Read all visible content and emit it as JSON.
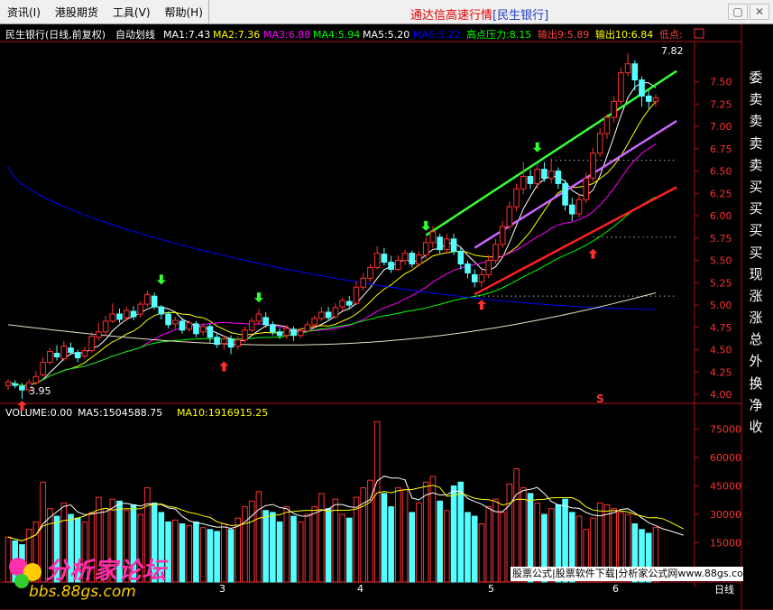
{
  "menu": {
    "items": [
      "资讯(I)",
      "港股期货",
      "工具(V)",
      "帮助(H)"
    ],
    "title_prefix": "通达信高速行情",
    "title_stock": "[民生银行]"
  },
  "window": {
    "restore_glyph": "▢",
    "close_glyph": "✕"
  },
  "header": {
    "name": "民生银行(日线,前复权)",
    "autodraw": "自动划线",
    "ma": [
      {
        "label": "MA1:7.43",
        "color": "#ffffff"
      },
      {
        "label": "MA2:7.36",
        "color": "#ffff00"
      },
      {
        "label": "MA3:6.88",
        "color": "#ff00ff"
      },
      {
        "label": "MA4:5.94",
        "color": "#00ff00"
      },
      {
        "label": "MA5:5.20",
        "color": "#ffffff"
      },
      {
        "label": "MA6:5.22",
        "color": "#0000ff"
      }
    ],
    "indicators": [
      {
        "label": "高点压力:8.15",
        "color": "#00ff00"
      },
      {
        "label": "输出9:5.89",
        "color": "#ff4040"
      },
      {
        "label": "输出10:6.84",
        "color": "#ffff00"
      },
      {
        "label": "低点:",
        "color": "#ff4040"
      }
    ]
  },
  "price_axis": [
    "7.50",
    "7.25",
    "7.00",
    "6.75",
    "6.50",
    "6.25",
    "6.00",
    "5.75",
    "5.50",
    "5.25",
    "5.00",
    "4.75",
    "4.50",
    "4.25",
    "4.00"
  ],
  "price_labels": {
    "high": "7.82",
    "low": "3.95",
    "marker": "S"
  },
  "right_panel": {
    "items": [
      "委",
      "卖",
      "卖",
      "卖",
      "卖",
      "买",
      "买",
      "买",
      "买",
      "现",
      "涨",
      "涨",
      "总",
      "外",
      "换",
      "净",
      "收"
    ],
    "colors": [
      "#ffffff",
      "#ffffff",
      "#ffffff",
      "#ffffff",
      "#ffffff",
      "#ffffff",
      "#ffffff",
      "#ffffff",
      "#ffffff",
      "#ffffff",
      "#ffffff",
      "#ffffff",
      "#ffffff",
      "#ffffff",
      "#ffffff",
      "#ffffff",
      "#ffffff"
    ]
  },
  "volume": {
    "header": "VOLUME:0.00",
    "ma5": "MA5:1504588.75",
    "ma10": "MA10:1916915.25",
    "axis": [
      "75000",
      "60000",
      "45000",
      "30000",
      "15000"
    ]
  },
  "time_axis": [
    "3",
    "4",
    "5",
    "6"
  ],
  "bottom": {
    "period": "日线"
  },
  "watermark": "股票公式|股票软件下载|分析家公式网www.88gs.com",
  "logo": {
    "brand": "分析家论坛",
    "url": "bbs.88gs.com"
  },
  "chart_data": {
    "type": "candlestick",
    "ylim": [
      3.9,
      7.95
    ],
    "candles": [
      {
        "o": 4.1,
        "c": 4.14,
        "h": 4.17,
        "l": 4.05
      },
      {
        "o": 4.12,
        "c": 4.1,
        "h": 4.16,
        "l": 4.07
      },
      {
        "o": 4.09,
        "c": 4.05,
        "h": 4.13,
        "l": 3.95
      },
      {
        "o": 4.05,
        "c": 4.13,
        "h": 4.17,
        "l": 4.02
      },
      {
        "o": 4.13,
        "c": 4.2,
        "h": 4.26,
        "l": 4.11
      },
      {
        "o": 4.22,
        "c": 4.36,
        "h": 4.42,
        "l": 4.2
      },
      {
        "o": 4.36,
        "c": 4.48,
        "h": 4.52,
        "l": 4.33
      },
      {
        "o": 4.46,
        "c": 4.42,
        "h": 4.55,
        "l": 4.38
      },
      {
        "o": 4.4,
        "c": 4.54,
        "h": 4.6,
        "l": 4.37
      },
      {
        "o": 4.52,
        "c": 4.47,
        "h": 4.58,
        "l": 4.44
      },
      {
        "o": 4.47,
        "c": 4.41,
        "h": 4.5,
        "l": 4.36
      },
      {
        "o": 4.43,
        "c": 4.49,
        "h": 4.53,
        "l": 4.4
      },
      {
        "o": 4.49,
        "c": 4.65,
        "h": 4.7,
        "l": 4.47
      },
      {
        "o": 4.64,
        "c": 4.7,
        "h": 4.8,
        "l": 4.6
      },
      {
        "o": 4.7,
        "c": 4.82,
        "h": 4.88,
        "l": 4.66
      },
      {
        "o": 4.82,
        "c": 4.9,
        "h": 5.02,
        "l": 4.8
      },
      {
        "o": 4.9,
        "c": 4.84,
        "h": 4.96,
        "l": 4.8
      },
      {
        "o": 4.86,
        "c": 4.94,
        "h": 4.98,
        "l": 4.82
      },
      {
        "o": 4.93,
        "c": 4.87,
        "h": 4.99,
        "l": 4.83
      },
      {
        "o": 4.9,
        "c": 5.01,
        "h": 5.04,
        "l": 4.86
      },
      {
        "o": 5.01,
        "c": 5.12,
        "h": 5.16,
        "l": 4.98
      },
      {
        "o": 5.1,
        "c": 4.98,
        "h": 5.14,
        "l": 4.95
      },
      {
        "o": 4.98,
        "c": 4.9,
        "h": 5.0,
        "l": 4.84
      },
      {
        "o": 4.9,
        "c": 4.78,
        "h": 4.93,
        "l": 4.74
      },
      {
        "o": 4.79,
        "c": 4.83,
        "h": 4.87,
        "l": 4.73
      },
      {
        "o": 4.82,
        "c": 4.72,
        "h": 4.86,
        "l": 4.68
      },
      {
        "o": 4.73,
        "c": 4.8,
        "h": 4.83,
        "l": 4.7
      },
      {
        "o": 4.79,
        "c": 4.68,
        "h": 4.82,
        "l": 4.64
      },
      {
        "o": 4.7,
        "c": 4.76,
        "h": 4.8,
        "l": 4.66
      },
      {
        "o": 4.76,
        "c": 4.64,
        "h": 4.79,
        "l": 4.58
      },
      {
        "o": 4.64,
        "c": 4.56,
        "h": 4.68,
        "l": 4.52
      },
      {
        "o": 4.57,
        "c": 4.62,
        "h": 4.66,
        "l": 4.5
      },
      {
        "o": 4.62,
        "c": 4.53,
        "h": 4.66,
        "l": 4.45
      },
      {
        "o": 4.54,
        "c": 4.61,
        "h": 4.65,
        "l": 4.5
      },
      {
        "o": 4.61,
        "c": 4.72,
        "h": 4.76,
        "l": 4.58
      },
      {
        "o": 4.72,
        "c": 4.82,
        "h": 4.86,
        "l": 4.7
      },
      {
        "o": 4.82,
        "c": 4.9,
        "h": 4.96,
        "l": 4.78
      },
      {
        "o": 4.86,
        "c": 4.78,
        "h": 4.92,
        "l": 4.75
      },
      {
        "o": 4.78,
        "c": 4.7,
        "h": 4.82,
        "l": 4.66
      },
      {
        "o": 4.7,
        "c": 4.66,
        "h": 4.74,
        "l": 4.62
      },
      {
        "o": 4.66,
        "c": 4.74,
        "h": 4.78,
        "l": 4.62
      },
      {
        "o": 4.73,
        "c": 4.66,
        "h": 4.76,
        "l": 4.6
      },
      {
        "o": 4.66,
        "c": 4.71,
        "h": 4.75,
        "l": 4.63
      },
      {
        "o": 4.71,
        "c": 4.78,
        "h": 4.82,
        "l": 4.69
      },
      {
        "o": 4.78,
        "c": 4.85,
        "h": 4.88,
        "l": 4.74
      },
      {
        "o": 4.85,
        "c": 4.92,
        "h": 4.98,
        "l": 4.82
      },
      {
        "o": 4.92,
        "c": 4.86,
        "h": 4.98,
        "l": 4.82
      },
      {
        "o": 4.87,
        "c": 4.97,
        "h": 5.02,
        "l": 4.85
      },
      {
        "o": 4.98,
        "c": 5.05,
        "h": 5.08,
        "l": 4.94
      },
      {
        "o": 5.04,
        "c": 5.0,
        "h": 5.1,
        "l": 4.96
      },
      {
        "o": 5.02,
        "c": 5.2,
        "h": 5.26,
        "l": 5.0
      },
      {
        "o": 5.2,
        "c": 5.3,
        "h": 5.36,
        "l": 5.16
      },
      {
        "o": 5.3,
        "c": 5.42,
        "h": 5.46,
        "l": 5.26
      },
      {
        "o": 5.42,
        "c": 5.58,
        "h": 5.66,
        "l": 5.4
      },
      {
        "o": 5.57,
        "c": 5.48,
        "h": 5.64,
        "l": 5.44
      },
      {
        "o": 5.48,
        "c": 5.4,
        "h": 5.55,
        "l": 5.36
      },
      {
        "o": 5.4,
        "c": 5.5,
        "h": 5.56,
        "l": 5.38
      },
      {
        "o": 5.5,
        "c": 5.58,
        "h": 5.62,
        "l": 5.45
      },
      {
        "o": 5.58,
        "c": 5.46,
        "h": 5.61,
        "l": 5.42
      },
      {
        "o": 5.46,
        "c": 5.56,
        "h": 5.6,
        "l": 5.43
      },
      {
        "o": 5.56,
        "c": 5.7,
        "h": 5.76,
        "l": 5.52
      },
      {
        "o": 5.7,
        "c": 5.82,
        "h": 5.88,
        "l": 5.64
      },
      {
        "o": 5.76,
        "c": 5.62,
        "h": 5.8,
        "l": 5.58
      },
      {
        "o": 5.62,
        "c": 5.74,
        "h": 5.8,
        "l": 5.58
      },
      {
        "o": 5.74,
        "c": 5.6,
        "h": 5.8,
        "l": 5.56
      },
      {
        "o": 5.6,
        "c": 5.46,
        "h": 5.64,
        "l": 5.4
      },
      {
        "o": 5.46,
        "c": 5.36,
        "h": 5.5,
        "l": 5.3
      },
      {
        "o": 5.34,
        "c": 5.26,
        "h": 5.4,
        "l": 5.2
      },
      {
        "o": 5.26,
        "c": 5.34,
        "h": 5.4,
        "l": 5.2
      },
      {
        "o": 5.34,
        "c": 5.5,
        "h": 5.56,
        "l": 5.3
      },
      {
        "o": 5.5,
        "c": 5.68,
        "h": 5.74,
        "l": 5.46
      },
      {
        "o": 5.68,
        "c": 5.88,
        "h": 5.94,
        "l": 5.64
      },
      {
        "o": 5.88,
        "c": 6.1,
        "h": 6.16,
        "l": 5.84
      },
      {
        "o": 6.1,
        "c": 6.3,
        "h": 6.36,
        "l": 6.05
      },
      {
        "o": 6.3,
        "c": 6.44,
        "h": 6.6,
        "l": 6.24
      },
      {
        "o": 6.44,
        "c": 6.36,
        "h": 6.52,
        "l": 6.3
      },
      {
        "o": 6.36,
        "c": 6.52,
        "h": 6.58,
        "l": 6.3
      },
      {
        "o": 6.52,
        "c": 6.42,
        "h": 6.6,
        "l": 6.38
      },
      {
        "o": 6.42,
        "c": 6.5,
        "h": 6.64,
        "l": 6.36
      },
      {
        "o": 6.5,
        "c": 6.36,
        "h": 6.54,
        "l": 6.3
      },
      {
        "o": 6.36,
        "c": 6.12,
        "h": 6.4,
        "l": 6.06
      },
      {
        "o": 6.12,
        "c": 6.02,
        "h": 6.2,
        "l": 5.94
      },
      {
        "o": 6.02,
        "c": 6.18,
        "h": 6.24,
        "l": 5.98
      },
      {
        "o": 6.18,
        "c": 6.42,
        "h": 6.48,
        "l": 6.14
      },
      {
        "o": 6.42,
        "c": 6.7,
        "h": 6.76,
        "l": 6.38
      },
      {
        "o": 6.7,
        "c": 6.92,
        "h": 6.98,
        "l": 6.66
      },
      {
        "o": 6.92,
        "c": 7.1,
        "h": 7.14,
        "l": 6.86
      },
      {
        "o": 7.1,
        "c": 7.28,
        "h": 7.34,
        "l": 7.04
      },
      {
        "o": 7.28,
        "c": 7.6,
        "h": 7.66,
        "l": 7.24
      },
      {
        "o": 7.6,
        "c": 7.7,
        "h": 7.82,
        "l": 7.56
      },
      {
        "o": 7.7,
        "c": 7.52,
        "h": 7.74,
        "l": 7.4
      },
      {
        "o": 7.52,
        "c": 7.34,
        "h": 7.56,
        "l": 7.22
      },
      {
        "o": 7.34,
        "c": 7.28,
        "h": 7.4,
        "l": 7.2
      },
      {
        "o": 7.28,
        "c": 7.32,
        "h": 7.36,
        "l": 7.22
      }
    ],
    "volume_ylim": [
      10000,
      80000
    ],
    "volumes": [
      18000,
      16000,
      14000,
      22000,
      26000,
      47000,
      33000,
      29000,
      36000,
      30000,
      28000,
      26000,
      31000,
      39000,
      33000,
      38000,
      37000,
      32000,
      35000,
      30000,
      44000,
      36000,
      31000,
      26000,
      27000,
      25000,
      24000,
      26000,
      23000,
      22000,
      21000,
      25000,
      22000,
      28000,
      34000,
      37000,
      42000,
      32000,
      31000,
      26000,
      34000,
      29000,
      26000,
      30000,
      34000,
      41000,
      33000,
      38000,
      30000,
      28000,
      39000,
      44000,
      48000,
      79000,
      41000,
      34000,
      44000,
      43000,
      31000,
      36000,
      47000,
      50000,
      37000,
      32000,
      45000,
      47000,
      31000,
      29000,
      25000,
      34000,
      38000,
      31000,
      46000,
      54000,
      44000,
      41000,
      36000,
      30000,
      33000,
      35000,
      38000,
      31000,
      29000,
      22000,
      28000,
      36000,
      35000,
      33000,
      31000,
      30000,
      25000,
      22000,
      20000,
      23000,
      22000,
      20000,
      16000,
      14000
    ],
    "volume_colors": "rising candles red outline, falling candles cyan filled"
  }
}
